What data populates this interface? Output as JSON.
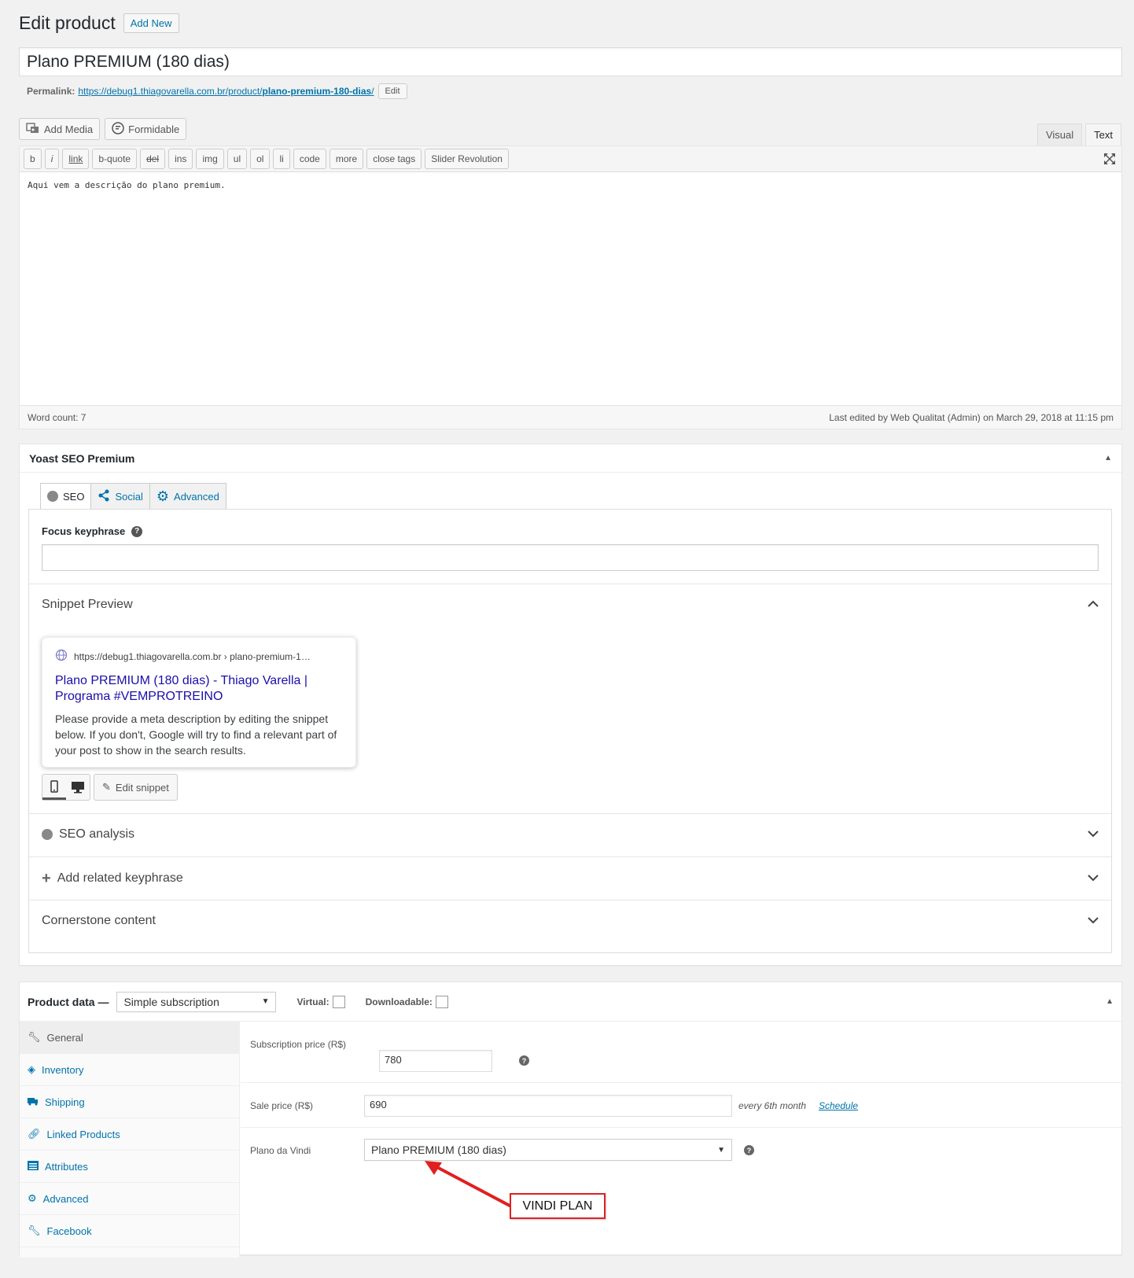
{
  "header": {
    "title": "Edit product",
    "add_new": "Add New"
  },
  "post_title": "Plano PREMIUM (180 dias)",
  "permalink": {
    "label": "Permalink:",
    "url_base": "https://debug1.thiagovarella.com.br/product/",
    "slug": "plano-premium-180-dias",
    "url_trail": "/",
    "edit_label": "Edit"
  },
  "editor": {
    "add_media": "Add Media",
    "formidable": "Formidable",
    "tabs": {
      "visual": "Visual",
      "text": "Text"
    },
    "quicktags": [
      "b",
      "i",
      "link",
      "b-quote",
      "del",
      "ins",
      "img",
      "ul",
      "ol",
      "li",
      "code",
      "more",
      "close tags",
      "Slider Revolution"
    ],
    "content": "Aqui vem a descrição do plano premium.",
    "word_count": "Word count: 7",
    "last_edited": "Last edited by Web Qualitat (Admin) on March 29, 2018 at 11:15 pm"
  },
  "yoast": {
    "title": "Yoast SEO Premium",
    "tabs": {
      "seo": "SEO",
      "social": "Social",
      "advanced": "Advanced"
    },
    "focus_keyphrase": "Focus keyphrase",
    "snippet_preview": "Snippet Preview",
    "snippet": {
      "url": "https://debug1.thiagovarella.com.br › plano-premium-1…",
      "title": "Plano PREMIUM (180 dias) - Thiago Varella | Programa #VEMPROTREINO",
      "description": "Please provide a meta description by editing the snippet below. If you don't, Google will try to find a relevant part of your post to show in the search results."
    },
    "edit_snippet": "Edit snippet",
    "seo_analysis": "SEO analysis",
    "add_related": "Add related keyphrase",
    "cornerstone": "Cornerstone content"
  },
  "product_data": {
    "label": "Product data —",
    "type": "Simple subscription",
    "virtual": "Virtual:",
    "downloadable": "Downloadable:",
    "tabs": [
      "General",
      "Inventory",
      "Shipping",
      "Linked Products",
      "Attributes",
      "Advanced",
      "Facebook"
    ],
    "subscription_price_label": "Subscription price (R$)",
    "subscription_price": "780",
    "sale_price_label": "Sale price (R$)",
    "sale_price": "690",
    "period_text": "every 6th month",
    "schedule": "Schedule",
    "vindi_label": "Plano da Vindi",
    "vindi_value": "Plano PREMIUM (180 dias)"
  },
  "annotation": {
    "callout": "VINDI PLAN"
  },
  "colors": {
    "link": "#0073aa",
    "snippet_title": "#1a0dab",
    "callout_border": "#e02020"
  }
}
